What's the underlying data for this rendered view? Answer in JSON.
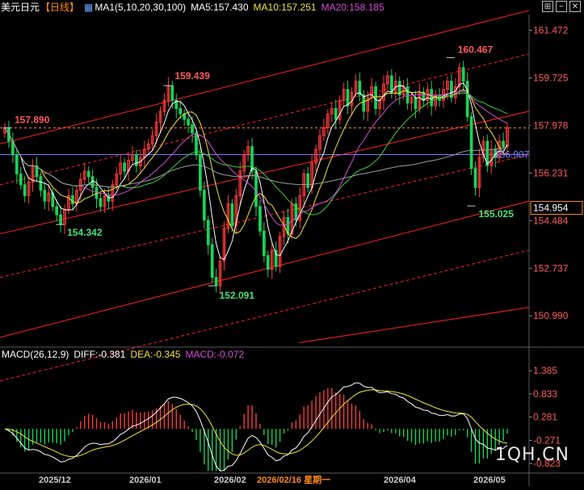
{
  "header": {
    "symbol": "美元日元",
    "period": "【日线】",
    "ma_group": "MA1(5,10,20,30,100)",
    "ma5": "MA5:157.430",
    "ma10": "MA10:157.251",
    "ma20": "MA20:158.185",
    "icons": [
      "grid-icon",
      "minus-icon",
      "close-icon"
    ]
  },
  "macd_header": {
    "name": "MACD(26,12,9)",
    "diff": "DIFF:-0.381",
    "dea": "DEA:-0.345",
    "macd": "MACD:-0.072"
  },
  "watermark": "1QH.CN",
  "colors": {
    "up": "#ff3b3b",
    "down": "#19d35a",
    "ma5": "#ffffff",
    "ma10": "#f2e33a",
    "ma20": "#d64bd6",
    "ma30": "#3ccf3c",
    "ma100": "#9c9c9c",
    "channel": "#ff2020",
    "hline": "#7a7aff"
  },
  "chart_data": [
    {
      "type": "candlestick",
      "title": "美元日元 日线",
      "y_ticks": [
        "161.472",
        "159.725",
        "157.978",
        "156.231",
        "154.484",
        "152.737",
        "150.990"
      ],
      "ylim": [
        149.9,
        162.05
      ],
      "x_ticks": [
        "2025/12",
        "2026/01",
        "2026/02",
        "2026/02/16 星期一",
        "2026/04",
        "2026/05"
      ],
      "last_price": "157.978",
      "price_labels": [
        "154.954",
        "156.907"
      ],
      "annotations": [
        {
          "text": "157.890",
          "value": 157.89
        },
        {
          "text": "159.439",
          "value": 159.439
        },
        {
          "text": "154.342",
          "value": 154.342
        },
        {
          "text": "152.091",
          "value": 152.091
        },
        {
          "text": "160.467",
          "value": 160.467
        },
        {
          "text": "155.025",
          "value": 155.025
        }
      ],
      "horizontal_lines": [
        {
          "value": 157.89,
          "style": "dashed",
          "color": "#ff8c1a"
        },
        {
          "value": 156.907,
          "style": "solid",
          "color": "#7a7aff"
        }
      ],
      "close_series": [
        157.9,
        157.4,
        156.9,
        156.2,
        155.8,
        155.4,
        155.9,
        156.5,
        156.1,
        155.6,
        155.2,
        155.5,
        155.0,
        154.7,
        154.342,
        154.9,
        155.4,
        155.1,
        155.6,
        156.0,
        156.3,
        156.1,
        155.7,
        155.3,
        155.0,
        155.4,
        155.2,
        155.8,
        156.2,
        156.6,
        156.3,
        156.7,
        156.9,
        156.5,
        156.8,
        157.1,
        157.3,
        157.6,
        158.1,
        158.5,
        158.9,
        159.439,
        158.9,
        158.6,
        158.4,
        158.2,
        158.0,
        157.7,
        156.9,
        155.6,
        154.5,
        153.6,
        152.4,
        152.091,
        153.0,
        154.2,
        155.1,
        154.3,
        155.4,
        156.3,
        156.9,
        157.2,
        156.3,
        155.0,
        154.1,
        153.2,
        152.7,
        153.4,
        152.8,
        153.9,
        154.6,
        154.0,
        155.1,
        154.5,
        155.4,
        156.2,
        155.7,
        156.6,
        157.1,
        157.6,
        157.9,
        158.4,
        158.6,
        158.2,
        158.9,
        159.3,
        158.7,
        159.2,
        159.6,
        159.1,
        158.5,
        159.0,
        159.4,
        158.6,
        158.9,
        159.5,
        159.8,
        159.2,
        159.6,
        159.1,
        159.4,
        158.8,
        159.0,
        158.6,
        159.2,
        158.9,
        159.3,
        158.7,
        159.1,
        158.9,
        159.3,
        159.6,
        159.0,
        159.4,
        160.1,
        159.6,
        158.3,
        156.4,
        155.7,
        156.8,
        157.4,
        156.5,
        157.1,
        156.8,
        157.4,
        157.2,
        157.9
      ],
      "ma_series": [
        {
          "name": "MA5"
        },
        {
          "name": "MA10"
        },
        {
          "name": "MA20"
        },
        {
          "name": "MA30"
        },
        {
          "name": "MA100"
        }
      ]
    },
    {
      "type": "macd",
      "y_ticks": [
        "1.385",
        "0.833",
        "0.281",
        "-0.271",
        "-0.823"
      ],
      "ylim": [
        -1.05,
        1.6
      ],
      "diff": -0.381,
      "dea": -0.345,
      "macd": -0.072
    }
  ]
}
